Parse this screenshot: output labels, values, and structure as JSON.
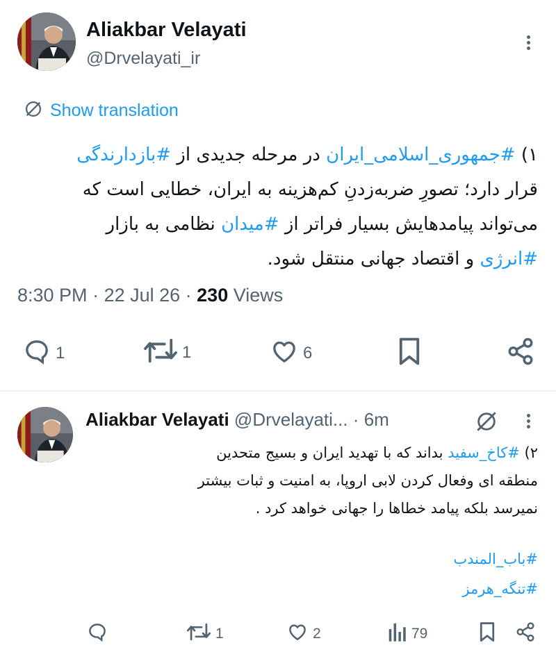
{
  "tweet1": {
    "author_name": "Aliakbar Velayati",
    "handle": "@Drvelayati_ir",
    "translate_label": "Show translation",
    "lines": [
      [
        {
          "t": "۱) ",
          "link": false
        },
        {
          "t": "#جمهوری_اسلامی_ایران",
          "link": true
        },
        {
          "t": " در مرحله جدیدی از ",
          "link": false
        },
        {
          "t": "#بازدارندگی",
          "link": true
        }
      ],
      [
        {
          "t": "قرار دارد؛ تصورِ ضربه‌زدنِ کم‌هزینه به ایران، خطایی است که",
          "link": false
        }
      ],
      [
        {
          "t": "می‌تواند پیامدهایش بسیار فراتر از ",
          "link": false
        },
        {
          "t": "#میدان",
          "link": true
        },
        {
          "t": " نظامی به بازار",
          "link": false
        }
      ],
      [
        {
          "t": "#انرژی",
          "link": true
        },
        {
          "t": " و اقتصاد جهانی منتقل شود.",
          "link": false
        }
      ]
    ],
    "time": "8:30 PM",
    "date": "22 Jul 26",
    "views_count": "230",
    "views_label": "Views",
    "actions": {
      "replies": "1",
      "retweets": "1",
      "likes": "6"
    }
  },
  "tweet2": {
    "author_name": "Aliakbar Velayati",
    "handle": "@Drvelayati...",
    "age": "6m",
    "lines": [
      [
        {
          "t": "۲) ",
          "link": false
        },
        {
          "t": "#کاخ_سفید",
          "link": true
        },
        {
          "t": "  بداند که با تهدید ایران و بسیج متحدین",
          "link": false
        }
      ],
      [
        {
          "t": "منطقه ای وفعال کردن لابی اروپا، به امنیت و ثبات بیشتر",
          "link": false
        }
      ],
      [
        {
          "t": "نمیرسد بلکه پیامد خطاها را جهانی خواهد کرد .",
          "link": false
        }
      ]
    ],
    "hashtags": [
      "#باب_المندب",
      "#تنگه_هرمز"
    ],
    "actions": {
      "retweets": "1",
      "likes": "2",
      "views": "79"
    }
  },
  "icons": {
    "more": "more-dots-icon",
    "translate": "globe-slash-icon",
    "reply": "reply-bubble-icon",
    "retweet": "retweet-icon",
    "like": "heart-icon",
    "bookmark": "bookmark-icon",
    "share": "share-icon",
    "views": "views-bars-icon",
    "grok": "grok-icon"
  },
  "colors": {
    "link": "#1d9bf0",
    "text": "#0f1419",
    "muted": "#536471",
    "divider": "#eff3f4"
  }
}
